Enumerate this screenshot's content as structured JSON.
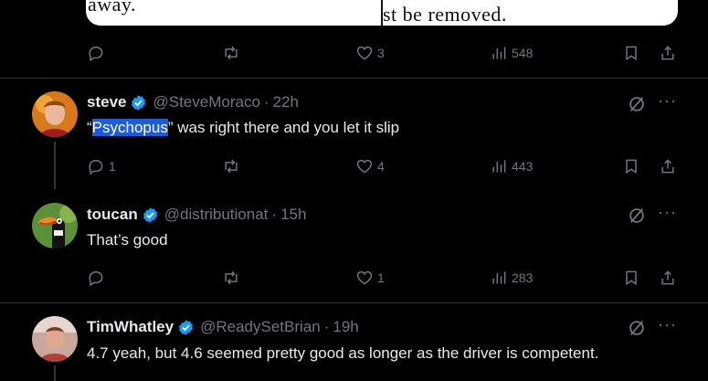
{
  "top_tweet": {
    "media_text_left": "away.",
    "media_text_right": "st be removed.",
    "actions": {
      "replies": "",
      "reposts": "",
      "likes": "3",
      "views": "548"
    }
  },
  "tweets": [
    {
      "name": "steve",
      "handle": "@SteveMoraco",
      "time": "22h",
      "text_before": "“",
      "text_selected": "Psychopus",
      "text_after": "” was right there and you let it slip",
      "actions": {
        "replies": "1",
        "reposts": "",
        "likes": "4",
        "views": "443"
      }
    },
    {
      "name": "toucan",
      "handle": "@distributionat",
      "time": "15h",
      "text": "That’s good",
      "actions": {
        "replies": "",
        "reposts": "",
        "likes": "1",
        "views": "283"
      }
    },
    {
      "name": "TimWhatley",
      "handle": "@ReadySetBrian",
      "time": "19h",
      "text": "4.7 yeah, but 4.6 seemed pretty good as longer as the driver is competent."
    }
  ],
  "separator": "·",
  "more_glyph": "···",
  "colors": {
    "background": "#000000",
    "text": "#e7e9ea",
    "muted": "#71767b",
    "verified": "#1d9bf0",
    "selection": "#1d5bd8"
  }
}
